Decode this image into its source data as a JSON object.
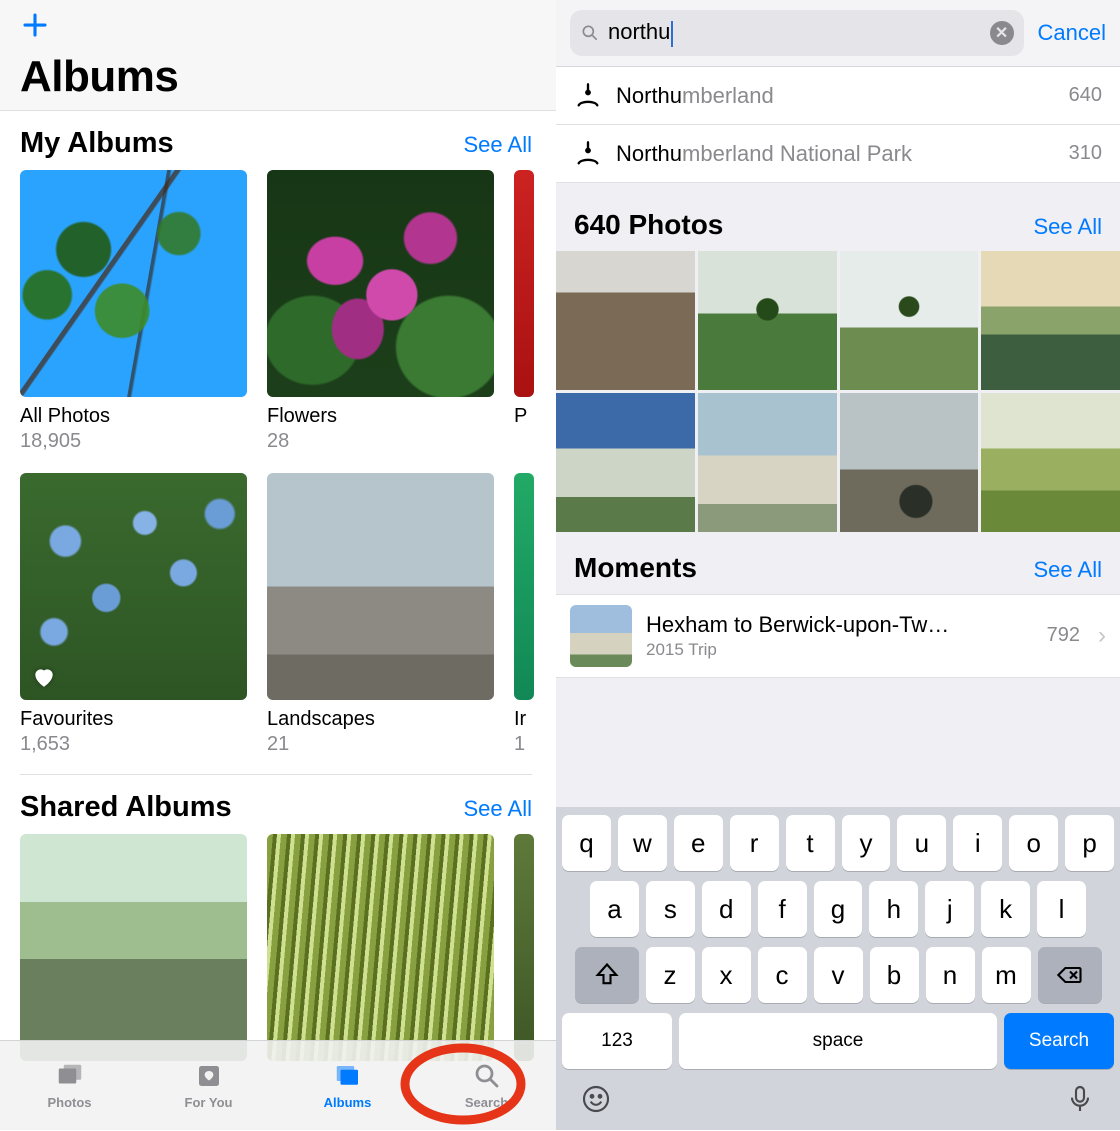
{
  "left": {
    "title": "Albums",
    "sections": {
      "my_albums": {
        "title": "My Albums",
        "see_all": "See All",
        "items": [
          {
            "name": "All Photos",
            "count": "18,905"
          },
          {
            "name": "Flowers",
            "count": "28"
          },
          {
            "name": "P",
            "count": ""
          },
          {
            "name": "Favourites",
            "count": "1,653"
          },
          {
            "name": "Landscapes",
            "count": "21"
          },
          {
            "name": "Ir",
            "count": "1"
          }
        ]
      },
      "shared": {
        "title": "Shared Albums",
        "see_all": "See All"
      }
    },
    "tabs": [
      {
        "label": "Photos"
      },
      {
        "label": "For You"
      },
      {
        "label": "Albums"
      },
      {
        "label": "Search"
      }
    ]
  },
  "right": {
    "search": {
      "query": "northu",
      "cancel": "Cancel"
    },
    "suggestions": [
      {
        "match": "Northu",
        "rest": "mberland",
        "count": "640"
      },
      {
        "match": "Northu",
        "rest": "mberland National Park",
        "count": "310"
      }
    ],
    "photos_section": {
      "title": "640 Photos",
      "see_all": "See All"
    },
    "moments_section": {
      "title": "Moments",
      "see_all": "See All"
    },
    "moment": {
      "title": "Hexham to Berwick-upon-Tw…",
      "subtitle": "2015 Trip",
      "count": "792"
    },
    "keyboard": {
      "row1": [
        "q",
        "w",
        "e",
        "r",
        "t",
        "y",
        "u",
        "i",
        "o",
        "p"
      ],
      "row2": [
        "a",
        "s",
        "d",
        "f",
        "g",
        "h",
        "j",
        "k",
        "l"
      ],
      "row3": [
        "z",
        "x",
        "c",
        "v",
        "b",
        "n",
        "m"
      ],
      "num": "123",
      "space": "space",
      "action": "Search"
    }
  }
}
